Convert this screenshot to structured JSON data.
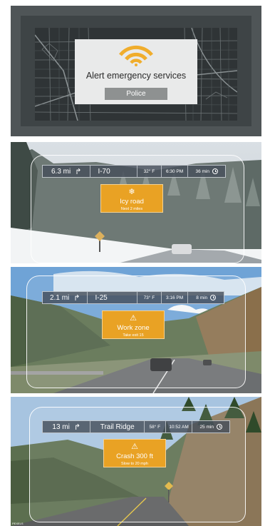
{
  "alert": {
    "title": "Alert emergency services",
    "button": "Police",
    "colors": {
      "accent": "#f0ad2c",
      "card": "#e9eaea",
      "button": "#8e9191"
    },
    "icon": "wifi-signal-icon"
  },
  "hud1": {
    "distance": "6.3 mi",
    "turn_icon": "↱",
    "road": "I-70",
    "temp": "32° F",
    "time": "6:30 PM",
    "eta": "36 min",
    "warning": {
      "icon": "❄",
      "title": "Icy road",
      "subtitle": "Next 2 miles"
    }
  },
  "hud2": {
    "distance": "2.1 mi",
    "turn_icon": "↱",
    "road": "I-25",
    "temp": "73° F",
    "time": "3:16 PM",
    "eta": "8 min",
    "warning": {
      "icon": "⚠",
      "title": "Work zone",
      "subtitle": "Take exit 15"
    }
  },
  "hud3": {
    "distance": "13 mi",
    "turn_icon": "↱",
    "road": "Trail Ridge",
    "temp": "58° F",
    "time": "10:52 AM",
    "eta": "25 min",
    "warning": {
      "icon": "⚠",
      "title": "Crash 300 ft",
      "subtitle": "Slow to 20 mph"
    },
    "credit": "PEXELS"
  },
  "warning_color": "#e9a224"
}
